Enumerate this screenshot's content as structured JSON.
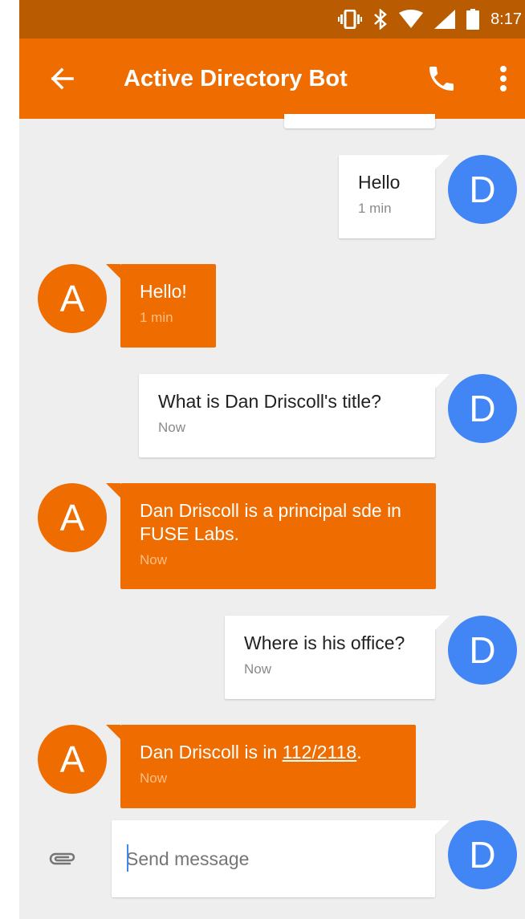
{
  "status_bar": {
    "time": "8:17",
    "icons": [
      "vibrate-icon",
      "bluetooth-icon",
      "wifi-icon",
      "signal-icon",
      "battery-icon"
    ]
  },
  "app_bar": {
    "title": "Active Directory Bot",
    "back_icon": "arrow-left-icon",
    "call_icon": "phone-icon",
    "menu_icon": "more-vert-icon"
  },
  "colors": {
    "accent": "#ef6c00",
    "status_bar": "#b95b00",
    "user_avatar": "#4285f4",
    "background": "#eeeeee"
  },
  "avatars": {
    "user_initial": "D",
    "bot_initial": "A"
  },
  "messages": [
    {
      "from": "user",
      "text": "Hello",
      "time": "1 min"
    },
    {
      "from": "bot",
      "text": "Hello!",
      "time": "1 min"
    },
    {
      "from": "user",
      "text": "What is Dan Driscoll's title?",
      "time": "Now"
    },
    {
      "from": "bot",
      "text": "Dan Driscoll is a principal sde in FUSE Labs.",
      "time": "Now"
    },
    {
      "from": "user",
      "text": "Where is his office?",
      "time": "Now"
    },
    {
      "from": "bot",
      "text_prefix": "Dan Driscoll is in ",
      "link": "112/2118",
      "text_suffix": ".",
      "time": "Now"
    }
  ],
  "composer": {
    "placeholder": "Send message",
    "value": "",
    "attach_icon": "paperclip-icon"
  }
}
